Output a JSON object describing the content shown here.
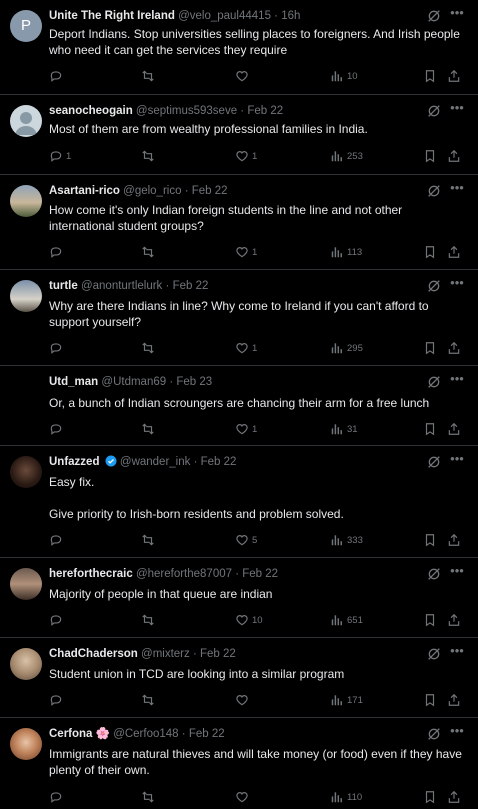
{
  "tweets": [
    {
      "name": "Unite The Right Ireland",
      "handle": "@velo_paul44415",
      "sep": "·",
      "time": "16h",
      "verified": false,
      "text": "Deport Indians. Stop universities selling places to foreigners. And Irish people who need it can get the services they require",
      "replies": "",
      "retweets": "",
      "likes": "",
      "views": "10",
      "avatar": "placeholder",
      "avatar_letter": "P"
    },
    {
      "name": "seanocheogain",
      "handle": "@septimus593seve",
      "sep": "·",
      "time": "Feb 22",
      "verified": false,
      "text": "Most of them are from wealthy professional families in India.",
      "replies": "1",
      "retweets": "",
      "likes": "1",
      "views": "253",
      "avatar": "default"
    },
    {
      "name": "Asartani-rico",
      "handle": "@gelo_rico",
      "sep": "·",
      "time": "Feb 22",
      "verified": false,
      "text": "How come it's only Indian foreign students in the line and not other international student groups?",
      "replies": "",
      "retweets": "",
      "likes": "1",
      "views": "113",
      "avatar": "photo"
    },
    {
      "name": "turtle",
      "handle": "@anonturtlelurk",
      "sep": "·",
      "time": "Feb 22",
      "verified": false,
      "text": "Why are there Indians in line? Why come to Ireland if you can't afford to support yourself?",
      "replies": "",
      "retweets": "",
      "likes": "1",
      "views": "295",
      "avatar": "photo"
    },
    {
      "name": "Utd_man",
      "handle": "@Utdman69",
      "sep": "·",
      "time": "Feb 23",
      "verified": false,
      "text": "Or, a bunch of Indian scroungers are chancing their arm for a free lunch",
      "replies": "",
      "retweets": "",
      "likes": "1",
      "views": "31",
      "avatar": "none"
    },
    {
      "name": "Unfazzed",
      "handle": "@wander_ink",
      "sep": "·",
      "time": "Feb 22",
      "verified": true,
      "text": "Easy fix.",
      "text2": "Give priority to Irish-born residents and problem solved.",
      "replies": "",
      "retweets": "",
      "likes": "5",
      "views": "333",
      "avatar": "photo"
    },
    {
      "name": "hereforthecraic",
      "handle": "@hereforthe87007",
      "sep": "·",
      "time": "Feb 22",
      "verified": false,
      "text": "Majority of people in that queue are indian",
      "replies": "",
      "retweets": "",
      "likes": "10",
      "views": "651",
      "avatar": "photo"
    },
    {
      "name": "ChadChaderson",
      "handle": "@mixterz",
      "sep": "·",
      "time": "Feb 22",
      "verified": false,
      "text": "Student union in TCD are looking into a similar program",
      "replies": "",
      "retweets": "",
      "likes": "",
      "views": "171",
      "avatar": "photo"
    },
    {
      "name": "Cerfona",
      "handle": "@Cerfoo148",
      "sep": "·",
      "time": "Feb 22",
      "verified": false,
      "flower": "🌸",
      "text": "Immigrants are natural thieves and will take money (or food) even if they have plenty of their own.",
      "replies": "",
      "retweets": "",
      "likes": "",
      "views": "110",
      "avatar": "photo"
    }
  ],
  "colors": {
    "accent": "#1d9bf0",
    "muted": "#71767b",
    "border": "#2f3336",
    "text": "#e7e9ea"
  },
  "icons": {
    "reply": "reply-icon",
    "retweet": "retweet-icon",
    "like": "heart-icon",
    "views": "views-icon",
    "bookmark": "bookmark-icon",
    "share": "share-icon",
    "grok": "grok-icon",
    "more": "more-icon"
  }
}
